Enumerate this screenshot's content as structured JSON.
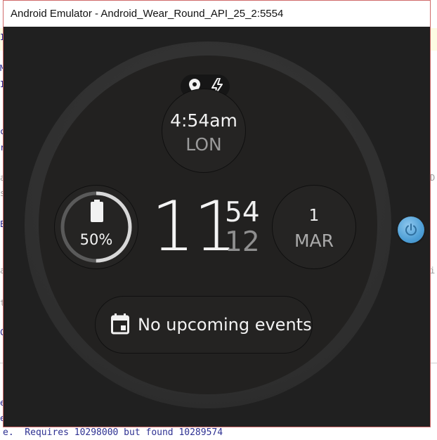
{
  "window": {
    "title": "Android Emulator - Android_Wear_Round_API_25_2:5554"
  },
  "background": {
    "bottom_line": "e.  Requires 10298000 but found 10289574",
    "left_fragments": [
      "I",
      "M",
      "I",
      "c",
      "r",
      "a",
      "s",
      "E",
      "a",
      "t",
      "C"
    ],
    "right_fragments": [
      "D.",
      "i."
    ],
    "bottom_left_fragments": [
      "e",
      "e"
    ]
  },
  "watch": {
    "status_icons": [
      "location-pin-icon",
      "charging-bolt-icon"
    ],
    "world_clock": {
      "time": "4:54am",
      "city": "LON"
    },
    "battery": {
      "percent_label": "50%",
      "level": 0.5
    },
    "time": {
      "hour": "11",
      "minutes": "54",
      "seconds": "12"
    },
    "date": {
      "day": "1",
      "month": "MAR"
    },
    "events": {
      "label": "No upcoming events",
      "icon": "calendar-icon"
    }
  },
  "controls": {
    "power_button_icon": "power-icon"
  },
  "colors": {
    "accent_power": "#4e9fd6",
    "face": "#222120",
    "bezel": "#2e2e2e"
  }
}
